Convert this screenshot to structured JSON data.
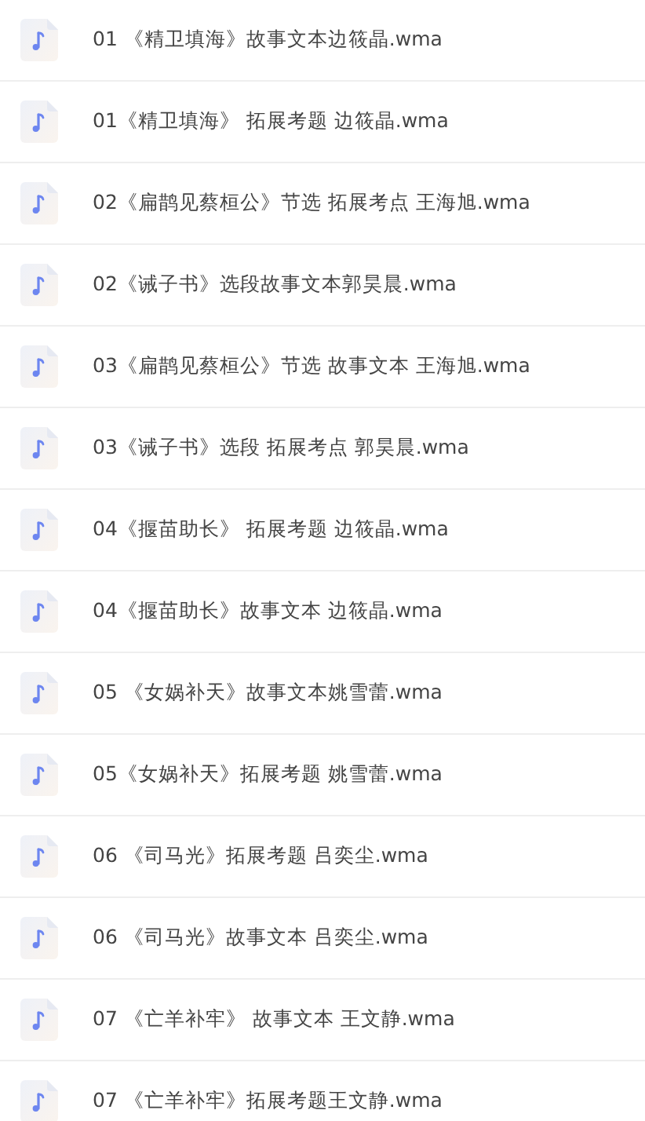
{
  "files": [
    {
      "name": "01 《精卫填海》故事文本边筱晶.wma",
      "kind": "audio"
    },
    {
      "name": "01《精卫填海》 拓展考题 边筱晶.wma",
      "kind": "audio"
    },
    {
      "name": "02《扁鹊见蔡桓公》节选 拓展考点 王海旭.wma",
      "kind": "audio"
    },
    {
      "name": "02《诫子书》选段故事文本郭昊晨.wma",
      "kind": "audio"
    },
    {
      "name": "03《扁鹊见蔡桓公》节选 故事文本 王海旭.wma",
      "kind": "audio"
    },
    {
      "name": "03《诫子书》选段 拓展考点 郭昊晨.wma",
      "kind": "audio"
    },
    {
      "name": "04《揠苗助长》 拓展考题 边筱晶.wma",
      "kind": "audio"
    },
    {
      "name": "04《揠苗助长》故事文本 边筱晶.wma",
      "kind": "audio"
    },
    {
      "name": "05 《女娲补天》故事文本姚雪蕾.wma",
      "kind": "audio"
    },
    {
      "name": "05《女娲补天》拓展考题 姚雪蕾.wma",
      "kind": "audio"
    },
    {
      "name": "06 《司马光》拓展考题 吕奕尘.wma",
      "kind": "audio"
    },
    {
      "name": "06 《司马光》故事文本 吕奕尘.wma",
      "kind": "audio"
    },
    {
      "name": "07 《亡羊补牢》 故事文本 王文静.wma",
      "kind": "audio"
    },
    {
      "name": "07 《亡羊补牢》拓展考题王文静.wma",
      "kind": "audio"
    }
  ]
}
